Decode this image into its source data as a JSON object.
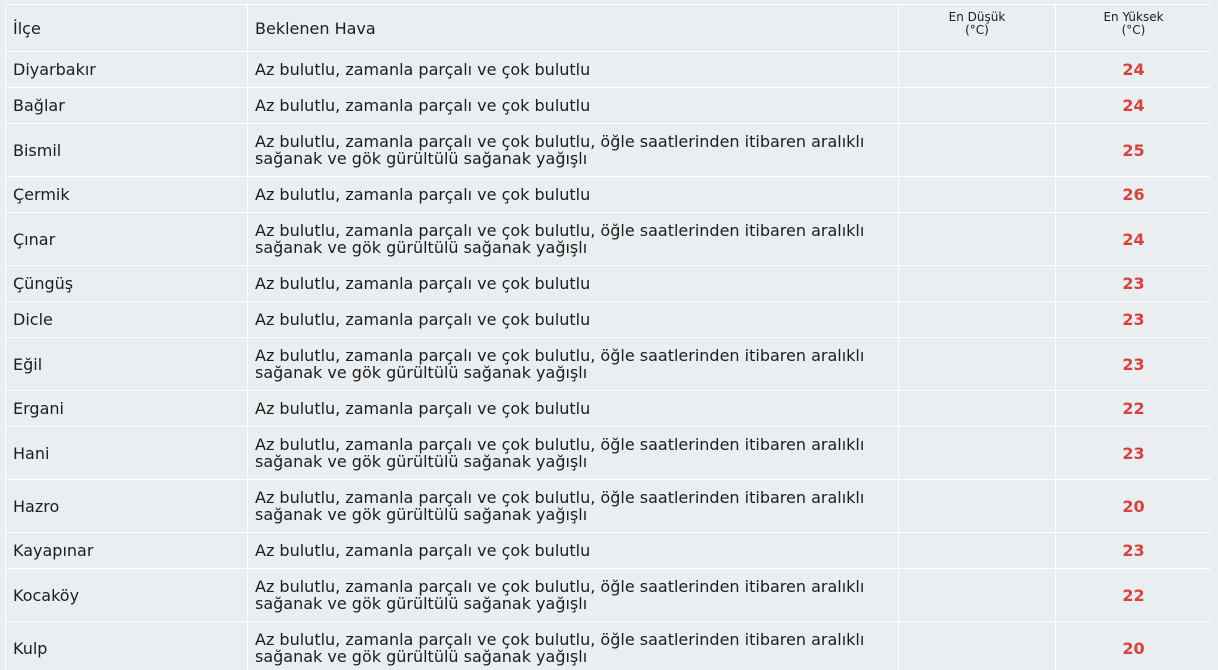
{
  "table": {
    "headers": {
      "district": "İlçe",
      "expected": "Beklenen Hava",
      "min_line1": "En Düşük",
      "min_line2": "(°C)",
      "max_line1": "En Yüksek",
      "max_line2": "(°C)"
    },
    "rows": [
      {
        "district": "Diyarbakır",
        "forecast": "Az bulutlu, zamanla parçalı ve çok bulutlu",
        "min": "",
        "max": "24",
        "tall": false
      },
      {
        "district": "Bağlar",
        "forecast": "Az bulutlu, zamanla parçalı ve çok bulutlu",
        "min": "",
        "max": "24",
        "tall": false
      },
      {
        "district": "Bismil",
        "forecast": "Az bulutlu, zamanla parçalı ve çok bulutlu, öğle saatlerinden itibaren aralıklı sağanak ve gök gürültülü sağanak yağışlı",
        "min": "",
        "max": "25",
        "tall": true
      },
      {
        "district": "Çermik",
        "forecast": "Az bulutlu, zamanla parçalı ve çok bulutlu",
        "min": "",
        "max": "26",
        "tall": false
      },
      {
        "district": "Çınar",
        "forecast": "Az bulutlu, zamanla parçalı ve çok bulutlu, öğle saatlerinden itibaren aralıklı sağanak ve gök gürültülü sağanak yağışlı",
        "min": "",
        "max": "24",
        "tall": true
      },
      {
        "district": "Çüngüş",
        "forecast": "Az bulutlu, zamanla parçalı ve çok bulutlu",
        "min": "",
        "max": "23",
        "tall": false
      },
      {
        "district": "Dicle",
        "forecast": "Az bulutlu, zamanla parçalı ve çok bulutlu",
        "min": "",
        "max": "23",
        "tall": false
      },
      {
        "district": "Eğil",
        "forecast": "Az bulutlu, zamanla parçalı ve çok bulutlu, öğle saatlerinden itibaren aralıklı sağanak ve gök gürültülü sağanak yağışlı",
        "min": "",
        "max": "23",
        "tall": true
      },
      {
        "district": "Ergani",
        "forecast": "Az bulutlu, zamanla parçalı ve çok bulutlu",
        "min": "",
        "max": "22",
        "tall": false
      },
      {
        "district": "Hani",
        "forecast": "Az bulutlu, zamanla parçalı ve çok bulutlu, öğle saatlerinden itibaren aralıklı sağanak ve gök gürültülü sağanak yağışlı",
        "min": "",
        "max": "23",
        "tall": true
      },
      {
        "district": "Hazro",
        "forecast": "Az bulutlu, zamanla parçalı ve çok bulutlu, öğle saatlerinden itibaren aralıklı sağanak ve gök gürültülü sağanak yağışlı",
        "min": "",
        "max": "20",
        "tall": true
      },
      {
        "district": "Kayapınar",
        "forecast": "Az bulutlu, zamanla parçalı ve çok bulutlu",
        "min": "",
        "max": "23",
        "tall": false
      },
      {
        "district": "Kocaköy",
        "forecast": "Az bulutlu, zamanla parçalı ve çok bulutlu, öğle saatlerinden itibaren aralıklı sağanak ve gök gürültülü sağanak yağışlı",
        "min": "",
        "max": "22",
        "tall": true
      },
      {
        "district": "Kulp",
        "forecast": "Az bulutlu, zamanla parçalı ve çok bulutlu, öğle saatlerinden itibaren aralıklı sağanak ve gök gürültülü sağanak yağışlı",
        "min": "",
        "max": "20",
        "tall": true
      }
    ]
  },
  "colors": {
    "background": "#eaeef1",
    "max_temp": "#d9413f",
    "border": "#ffffff"
  }
}
